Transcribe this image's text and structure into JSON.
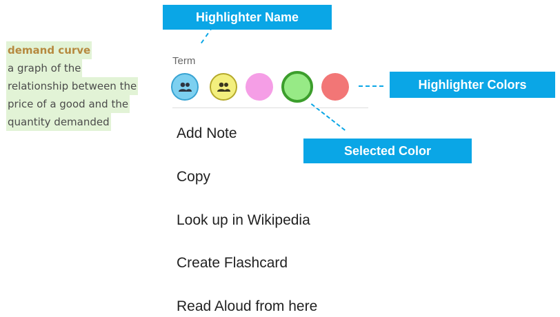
{
  "glossary": {
    "term": "demand curve",
    "definition_lines": [
      "a graph of the",
      "relationship between the",
      "price of a good and the",
      "quantity demanded"
    ]
  },
  "callouts": {
    "highlighter_name": "Highlighter Name",
    "highlighter_colors": "Highlighter Colors",
    "selected_color": "Selected Color"
  },
  "popup": {
    "highlighter_label": "Term",
    "swatches": [
      {
        "name": "blue",
        "color": "#7dd0f0",
        "icon": "people-icon"
      },
      {
        "name": "yellow",
        "color": "#f3ef7e",
        "icon": "people-icon"
      },
      {
        "name": "pink",
        "color": "#f59ee6"
      },
      {
        "name": "green",
        "color": "#97ea86",
        "selected": true
      },
      {
        "name": "red",
        "color": "#f27676"
      }
    ],
    "menu": [
      "Add Note",
      "Copy",
      "Look up in Wikipedia",
      "Create Flashcard",
      "Read Aloud from here"
    ]
  },
  "colors": {
    "callout": "#0aa6e6",
    "highlight": "#e2f3d6",
    "term_text": "#b6893f"
  }
}
